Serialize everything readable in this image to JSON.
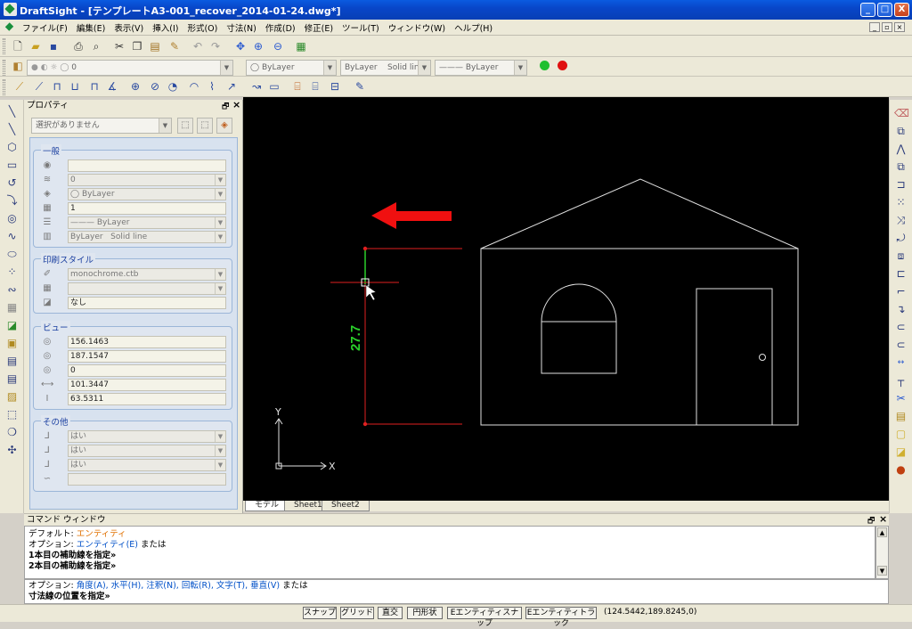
{
  "title": "DraftSight - [テンプレートA3-001_recover_2014-01-24.dwg*]",
  "window_buttons": [
    "_",
    "□",
    "X"
  ],
  "menu": [
    "ファイル(F)",
    "編集(E)",
    "表示(V)",
    "挿入(I)",
    "形式(O)",
    "寸法(N)",
    "作成(D)",
    "修正(E)",
    "ツール(T)",
    "ウィンドウ(W)",
    "ヘルプ(H)"
  ],
  "layer_toolbar": {
    "layer_value": "0",
    "color": "ByLayer",
    "linetype_label": "ByLayer",
    "linetype_name": "Solid line",
    "lineweight": "ByLayer"
  },
  "properties": {
    "title": "プロパティ",
    "selection": "選択がありません",
    "general_label": "一般",
    "general": [
      "",
      "0",
      "ByLayer",
      "1",
      "ByLayer",
      "ByLayer   Solid line"
    ],
    "print_style_label": "印刷スタイル",
    "print_style": [
      "monochrome.ctb",
      "",
      "なし"
    ],
    "view_label": "ビュー",
    "view": [
      "156.1463",
      "187.1547",
      "0",
      "101.3447",
      "63.5311"
    ],
    "other_label": "その他",
    "other": [
      "はい",
      "はい",
      "はい",
      ""
    ]
  },
  "drawing": {
    "dimension_text": "27.7",
    "axis_x": "X",
    "axis_y": "Y"
  },
  "sheet_tabs": [
    "モデル",
    "Sheet1",
    "Sheet2"
  ],
  "command": {
    "title": "コマンド ウィンドウ",
    "line1_prefix": "デフォルト: ",
    "line1_value": "エンティティ",
    "line2_prefix": "オプション: ",
    "line2_value": "エンティティ(E)",
    "line2_suffix": " または",
    "line3": "1本目の補助線を指定»",
    "line4": "2本目の補助線を指定»",
    "input_prefix": "オプション: ",
    "input_options": "角度(A), 水平(H), 注釈(N), 回転(R), 文字(T), 垂直(V)",
    "input_suffix": " または",
    "input_prompt": "寸法線の位置を指定»"
  },
  "status": {
    "buttons": [
      "スナップ",
      "グリッド",
      "直交",
      "円形状",
      "Eエンティティスナップ",
      "Eエンティティトラック"
    ],
    "coords": "(124.5442,189.8245,0)"
  }
}
